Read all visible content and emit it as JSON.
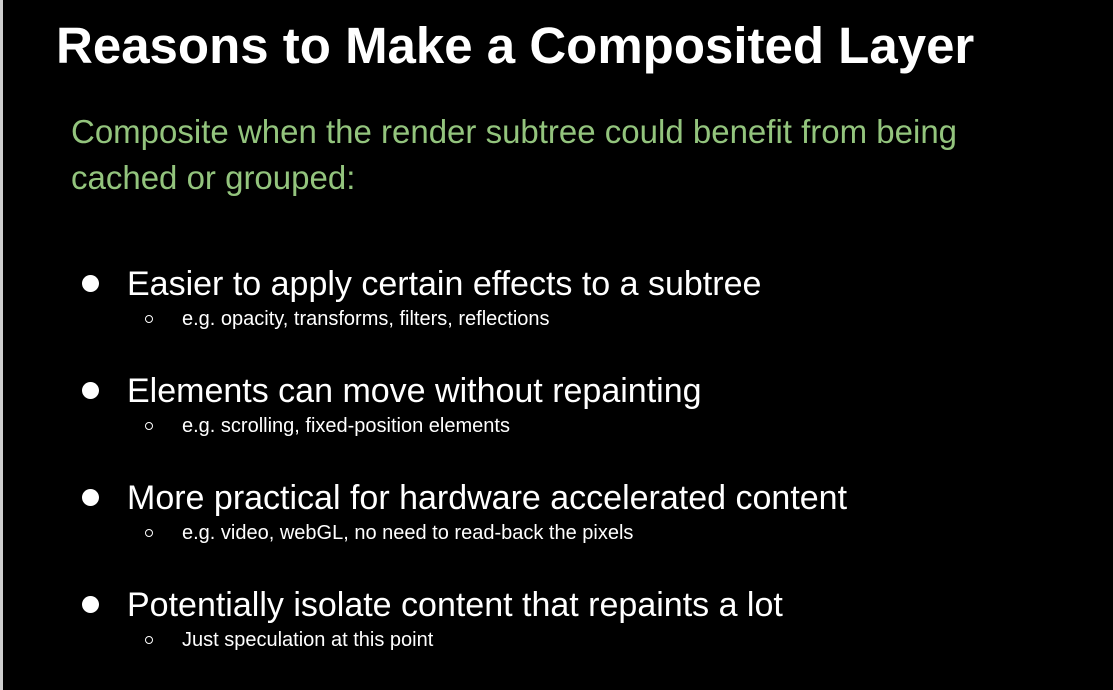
{
  "slide": {
    "title": "Reasons to Make a Composited Layer",
    "subtitle": "Composite when the render subtree could benefit from being cached or grouped:",
    "bullets": [
      {
        "text": "Easier to apply certain effects to a subtree",
        "sub": "e.g. opacity, transforms, filters, reflections"
      },
      {
        "text": "Elements can move without repainting",
        "sub": "e.g. scrolling, fixed-position elements"
      },
      {
        "text": "More practical for hardware accelerated content",
        "sub": "e.g. video, webGL, no need to read-back the pixels"
      },
      {
        "text": "Potentially isolate content that repaints a lot",
        "sub": "Just speculation at this point"
      }
    ]
  },
  "colors": {
    "background": "#000000",
    "title": "#ffffff",
    "subtitle": "#93c47d",
    "text": "#ffffff"
  }
}
